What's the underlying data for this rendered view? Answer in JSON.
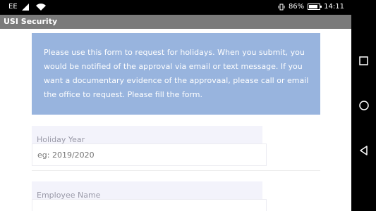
{
  "status_bar": {
    "carrier": "EE",
    "battery_percent": "86%",
    "battery_level": 0.86,
    "time": "14:11",
    "icons": [
      "signal-icon",
      "wifi-icon",
      "vibrate-icon",
      "battery-icon"
    ]
  },
  "app": {
    "title": "USI Security"
  },
  "info_box": {
    "text": "Please use this form to request for holidays. When you submit, you would be notified of the approval via email or text message. If you want a documentary evidence of the approvaal, please call or email the office to request. Please fill the form.",
    "background": "#98b4de"
  },
  "form": {
    "holiday_year": {
      "label": "Holiday Year",
      "placeholder": "eg: 2019/2020",
      "value": ""
    },
    "employee_name": {
      "label": "Employee Name"
    }
  },
  "nav": {
    "icons": [
      "recents-square-icon",
      "home-circle-icon",
      "back-triangle-icon"
    ]
  }
}
